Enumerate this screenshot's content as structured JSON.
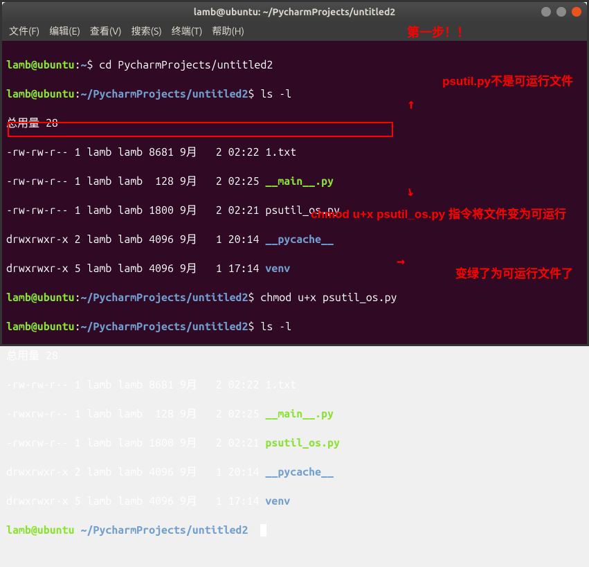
{
  "titlebar": {
    "title": "lamb@ubuntu: ~/PycharmProjects/untitled2"
  },
  "menu": {
    "file": "文件(F)",
    "edit": "编辑(E)",
    "view": "查看(V)",
    "search": "搜索(S)",
    "terminal": "终端(T)",
    "help": "帮助(H)"
  },
  "prompts": {
    "user": "lamb@ubuntu",
    "sep": ":",
    "home": "~",
    "path": "~/PycharmProjects/untitled2",
    "sym": "$"
  },
  "cmds": {
    "cd": " cd PycharmProjects/untitled2",
    "ls1": " ls -l",
    "chmod": " chmod u+x psutil_os.py",
    "ls2": " ls -l"
  },
  "listing1": {
    "total": "总用量 28",
    "row1": "-rw-rw-r-- 1 lamb lamb 8681 9月   2 02:22 ",
    "row1f": "1.txt",
    "row2": "-rw-rw-r-- 1 lamb lamb  128 9月   2 02:25 ",
    "row2f": "__main__.py",
    "row3": "-rw-rw-r-- 1 lamb lamb 1800 9月   2 02:21 ",
    "row3f": "psutil_os.py",
    "row4": "drwxrwxr-x 2 lamb lamb 4096 9月   1 20:14 ",
    "row4f": "__pycache__",
    "row5": "drwxrwxr-x 5 lamb lamb 4096 9月   1 17:14 ",
    "row5f": "venv"
  },
  "listing2": {
    "total": "总用量 28",
    "row1": "-rw-rw-r-- 1 lamb lamb 8681 9月   2 02:22 ",
    "row1f": "1.txt",
    "row2": "-rwxrw-r-- 1 lamb lamb  128 9月   2 02:25 ",
    "row2f": "__main__.py",
    "row3": "-rwxrw-r-- 1 lamb lamb 1800 9月   2 02:21 ",
    "row3f": "psutil_os.py",
    "row4": "drwxrwxr-x 2 lamb lamb 4096 9月   1 20:14 ",
    "row4f": "__pycache__",
    "row5": "drwxrwxr-x 5 lamb lamb 4096 9月   1 17:14 ",
    "row5f": "venv"
  },
  "annotations": {
    "step1": "第一步！！",
    "note1": "psutil.py不是可运行文件",
    "note2": "chmod u+x psutil_os.py\n指令将文件变为可运行",
    "note3": "变绿了为可运行文件了",
    "arrow_up": "↑",
    "arrow_diag": "↘",
    "arrow_right": "→"
  }
}
